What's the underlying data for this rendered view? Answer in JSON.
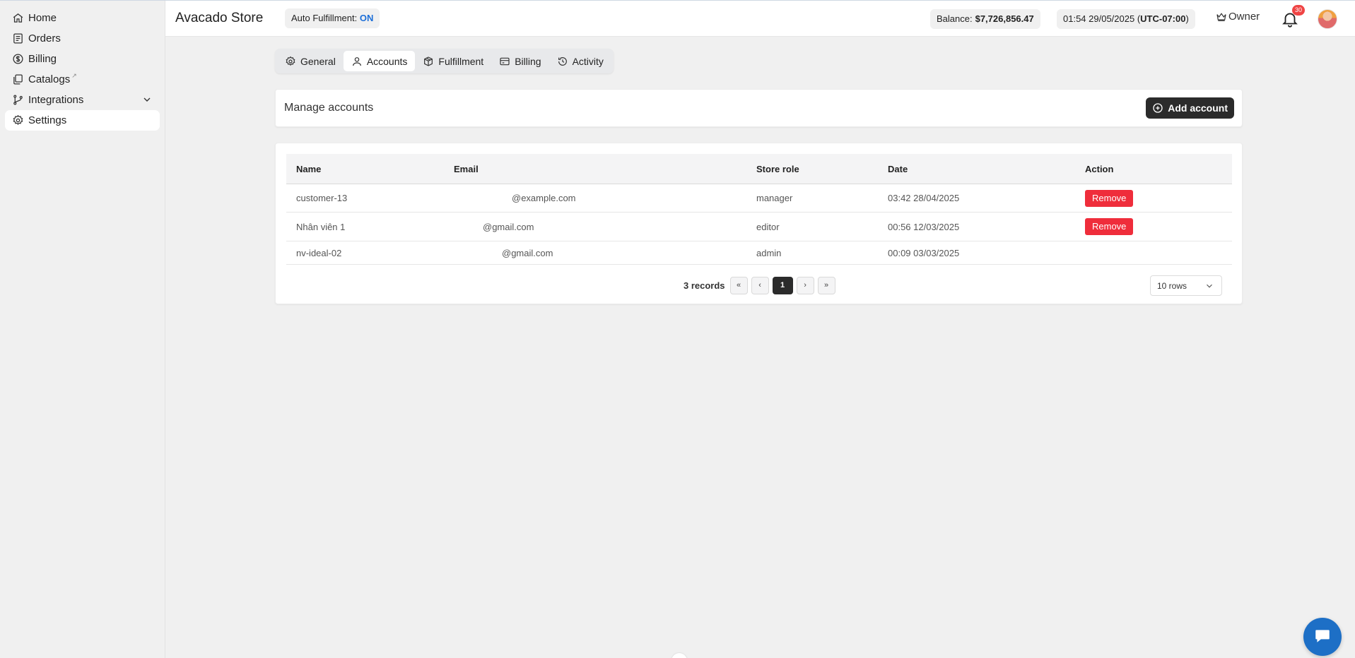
{
  "sidebar": {
    "items": [
      {
        "label": "Home"
      },
      {
        "label": "Orders"
      },
      {
        "label": "Billing"
      },
      {
        "label": "Catalogs",
        "external_mark": "↗"
      },
      {
        "label": "Integrations"
      },
      {
        "label": "Settings"
      }
    ]
  },
  "header": {
    "store_title": "Avacado Store",
    "auto_fulfillment_label": "Auto Fulfillment:",
    "auto_fulfillment_value": "ON",
    "balance_label": "Balance:",
    "balance_value": "$7,726,856.47",
    "time_text": "01:54 29/05/2025 (",
    "timezone": "UTC-07:00",
    "time_close": ")",
    "role": "Owner",
    "notification_count": "30"
  },
  "tabs": [
    {
      "label": "General"
    },
    {
      "label": "Accounts"
    },
    {
      "label": "Fulfillment"
    },
    {
      "label": "Billing"
    },
    {
      "label": "Activity"
    }
  ],
  "manage": {
    "title": "Manage accounts",
    "add_label": "Add account"
  },
  "table": {
    "columns": [
      "Name",
      "Email",
      "Store role",
      "Date",
      "Action"
    ],
    "rows": [
      {
        "name": "customer-13",
        "email": "@example.com",
        "role": "manager",
        "date": "03:42 28/04/2025",
        "action": "Remove"
      },
      {
        "name": "Nhân viên 1",
        "email": "@gmail.com",
        "role": "editor",
        "date": "00:56 12/03/2025",
        "action": "Remove"
      },
      {
        "name": "nv-ideal-02",
        "email": "@gmail.com",
        "role": "admin",
        "date": "00:09 03/03/2025",
        "action": ""
      }
    ],
    "records_text": "3 records",
    "current_page": "1",
    "rows_per_page": "10 rows",
    "first_label": "«",
    "prev_label": "‹",
    "next_label": "›",
    "last_label": "»"
  },
  "colors": {
    "accent_on": "#1d6fd8",
    "remove_red": "#ef2d3b",
    "dark_button": "#2b2b2b",
    "chat_blue": "#1d6fc6",
    "badge_red": "#ef4444"
  }
}
